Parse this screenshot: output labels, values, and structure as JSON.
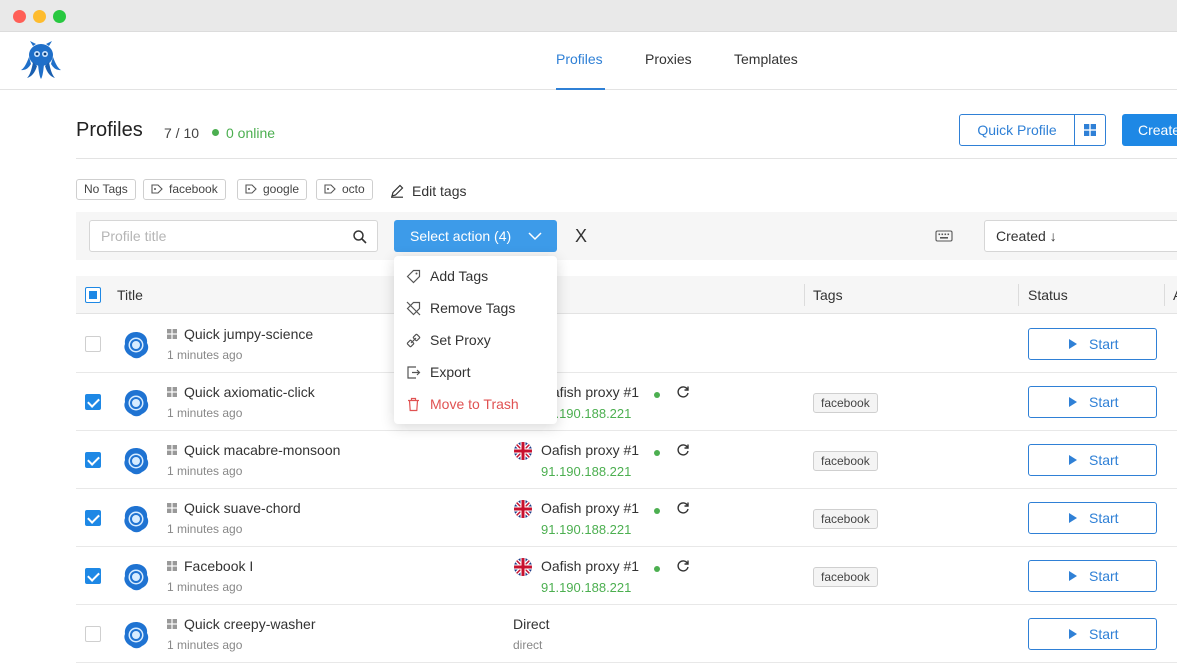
{
  "nav": {
    "tabs": [
      {
        "label": "Profiles"
      },
      {
        "label": "Proxies"
      },
      {
        "label": "Templates"
      }
    ]
  },
  "header": {
    "title": "Profiles",
    "count": "7 / 10",
    "online": "0 online",
    "quick_profile": "Quick Profile",
    "create": "Create"
  },
  "tags": {
    "items": [
      {
        "label": "No Tags"
      },
      {
        "label": "facebook"
      },
      {
        "label": "google"
      },
      {
        "label": "octo"
      }
    ],
    "edit_label": "Edit tags"
  },
  "toolbar": {
    "search_placeholder": "Profile title",
    "select_action": "Select action (4)",
    "clear": "X",
    "sort": "Created ↓"
  },
  "menu": {
    "items": [
      {
        "label": "Add Tags",
        "icon": "tag-icon"
      },
      {
        "label": "Remove Tags",
        "icon": "tag-off-icon"
      },
      {
        "label": "Set Proxy",
        "icon": "plug-icon"
      },
      {
        "label": "Export",
        "icon": "export-icon"
      },
      {
        "label": "Move to Trash",
        "icon": "trash-icon"
      }
    ]
  },
  "table": {
    "headers": {
      "title": "Title",
      "tags": "Tags",
      "status": "Status",
      "overflow": "A"
    },
    "rows": [
      {
        "name": "Quick jumpy-science",
        "time": "1 minutes ago",
        "checked": false,
        "proxy": null,
        "tag": null,
        "action": "Start"
      },
      {
        "name": "Quick axiomatic-click",
        "time": "1 minutes ago",
        "checked": true,
        "proxy": {
          "name": "Oafish proxy #1",
          "ip": "91.190.188.221"
        },
        "tag": "facebook",
        "action": "Start"
      },
      {
        "name": "Quick macabre-monsoon",
        "time": "1 minutes ago",
        "checked": true,
        "proxy": {
          "name": "Oafish proxy #1",
          "ip": "91.190.188.221"
        },
        "tag": "facebook",
        "action": "Start"
      },
      {
        "name": "Quick suave-chord",
        "time": "1 minutes ago",
        "checked": true,
        "proxy": {
          "name": "Oafish proxy #1",
          "ip": "91.190.188.221"
        },
        "tag": "facebook",
        "action": "Start"
      },
      {
        "name": "Facebook I",
        "time": "1 minutes ago",
        "checked": true,
        "proxy": {
          "name": "Oafish proxy #1",
          "ip": "91.190.188.221"
        },
        "tag": "facebook",
        "action": "Start"
      },
      {
        "name": "Quick creepy-washer",
        "time": "1 minutes ago",
        "checked": false,
        "direct": {
          "name": "Direct",
          "sub": "direct"
        },
        "tag": null,
        "action": "Start"
      }
    ]
  },
  "colors": {
    "accent": "#1e88e5",
    "online": "#4caf50",
    "danger": "#e05252"
  }
}
